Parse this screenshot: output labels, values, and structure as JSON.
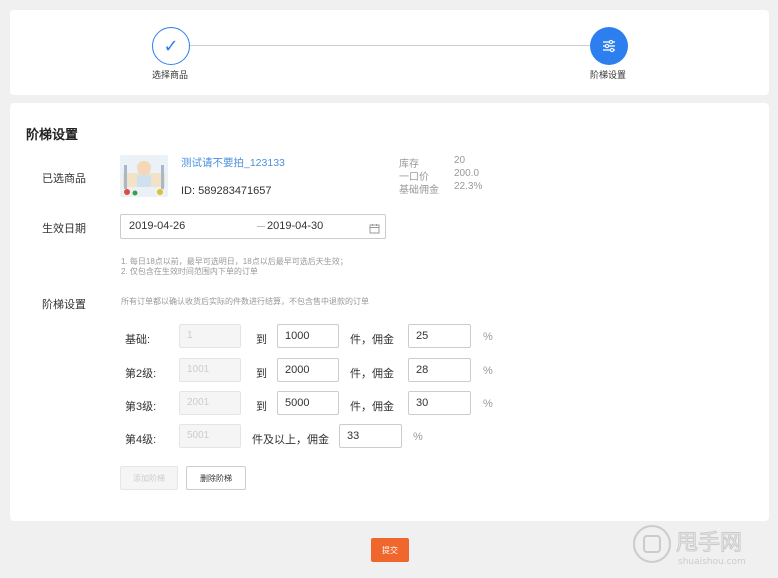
{
  "steps": [
    {
      "label": "选择商品",
      "status": "done"
    },
    {
      "label": "阶梯设置",
      "status": "active"
    }
  ],
  "section": {
    "title": "阶梯设置"
  },
  "product": {
    "row_label": "已选商品",
    "name": "测试请不要拍_123133",
    "id_text": "ID: 589283471657",
    "stats": [
      {
        "label": "库存",
        "value": "20"
      },
      {
        "label": "一口价",
        "value": "200.0"
      },
      {
        "label": "基础佣金",
        "value": "22.3%"
      }
    ]
  },
  "date": {
    "row_label": "生效日期",
    "start": "2019-04-26",
    "end": "2019-04-30",
    "icon": "calendar-icon"
  },
  "notes": [
    "1. 每日18点以前，最早可选明日，18点以后最早可选后天生效；",
    "2. 仅包含在生效时间范围内下单的订单"
  ],
  "tiers": {
    "row_label": "阶梯设置",
    "description": "所有订单都以确认收货后实际的件数进行结算，不包含售中退款的订单",
    "to_label": "到",
    "unit_commission": "件，佣金",
    "above_label": "件及以上，佣金",
    "percent": "%",
    "rows": [
      {
        "label": "基础:",
        "from": "1",
        "to": "1000",
        "commission": "25"
      },
      {
        "label": "第2级:",
        "from": "1001",
        "to": "2000",
        "commission": "28"
      },
      {
        "label": "第3级:",
        "from": "2001",
        "to": "5000",
        "commission": "30"
      },
      {
        "label": "第4级:",
        "from": "5001",
        "to": "",
        "commission": "33"
      }
    ]
  },
  "buttons": {
    "add_tier": "添加阶梯",
    "delete_tier": "删除阶梯",
    "submit": "提交"
  },
  "colors": {
    "primary": "#2d7ff0",
    "submit": "#f0672e",
    "link": "#4a8fdf"
  },
  "watermark": {
    "text": "甩手网",
    "subtext": "shuaishou.com"
  }
}
